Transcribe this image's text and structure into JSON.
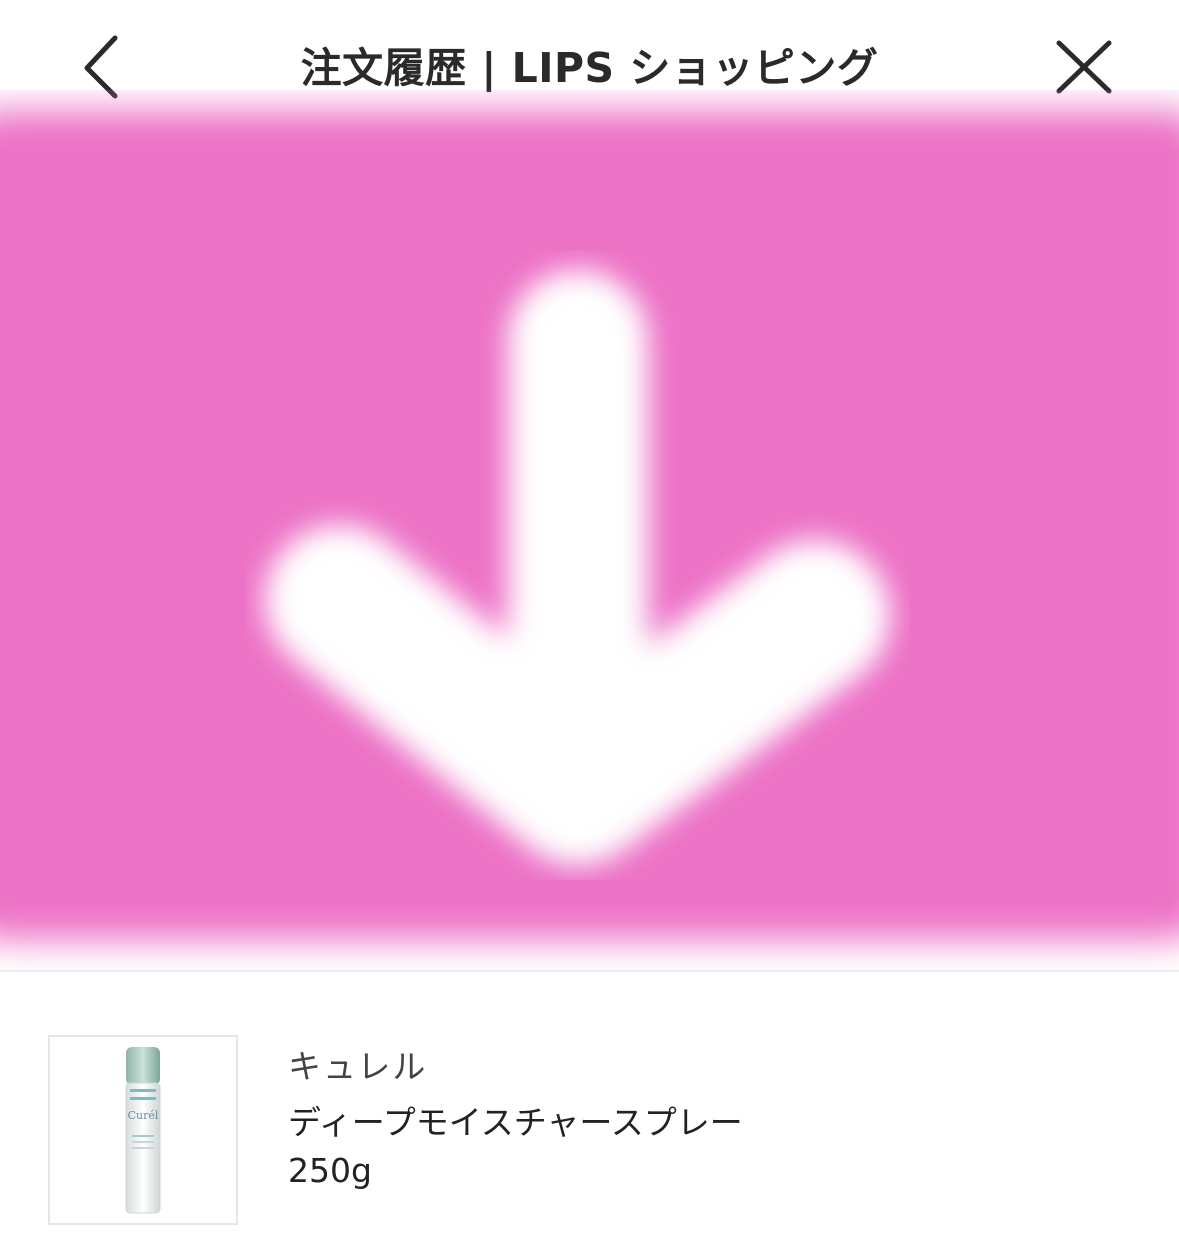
{
  "header": {
    "title": "注文履歴 | LIPS ショッピング",
    "back_icon": "chevron-left-icon",
    "close_icon": "close-icon"
  },
  "banner": {
    "icon": "arrow-down-icon",
    "overlay_color": "#ec72c6"
  },
  "product": {
    "brand": "キュレル",
    "name": "ディープモイスチャースプレー",
    "variant": "250g",
    "image_icon": "spray-bottle-icon"
  }
}
